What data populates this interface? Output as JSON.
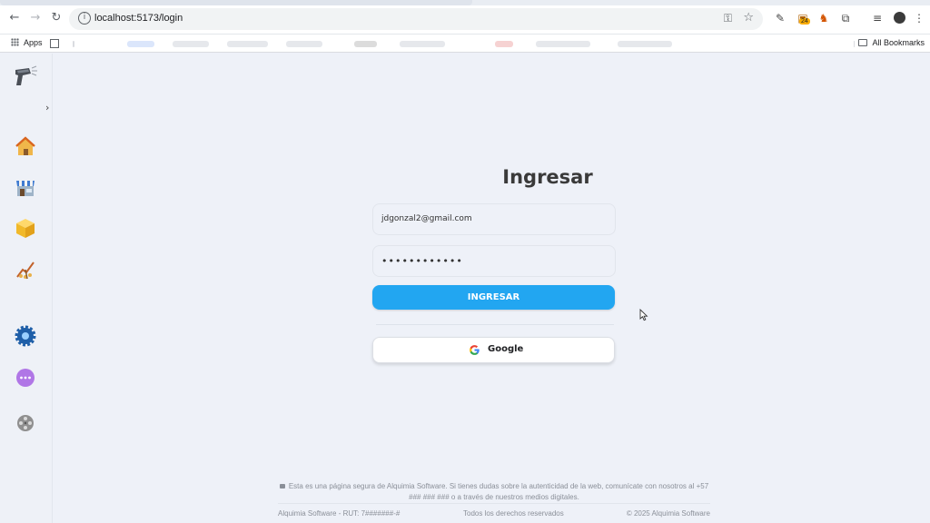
{
  "browser": {
    "url": "localhost:5173/login",
    "extension_badge": "24",
    "bookmarks": {
      "apps_label": "Apps",
      "all_bookmarks_label": "All Bookmarks"
    }
  },
  "sidebar": {
    "items": [
      {
        "name": "home",
        "icon": "home-icon"
      },
      {
        "name": "store",
        "icon": "store-icon"
      },
      {
        "name": "inventory",
        "icon": "box-icon"
      },
      {
        "name": "analytics",
        "icon": "chart-icon"
      },
      {
        "name": "settings",
        "icon": "gear-icon"
      },
      {
        "name": "more",
        "icon": "more-icon"
      },
      {
        "name": "misc",
        "icon": "film-reel-icon"
      }
    ]
  },
  "login": {
    "title": "Ingresar",
    "email_value": "jdgonzal2@gmail.com",
    "password_value": "••••••••••••",
    "submit_label": "INGRESAR",
    "google_label": "Google"
  },
  "footer": {
    "security_note": "Esta es una página segura de Alquimia Software. Si tienes dudas sobre la autenticidad de la web, comunícate con nosotros al +57 ### ### ### o a través de nuestros medios digitales.",
    "company_rut": "Alquimia Software - RUT: 7#######-#",
    "rights": "Todos los derechos reservados",
    "copyright": "© 2025 Alquimia Software"
  },
  "colors": {
    "primary": "#22a6f1",
    "background": "#eef1f8"
  }
}
